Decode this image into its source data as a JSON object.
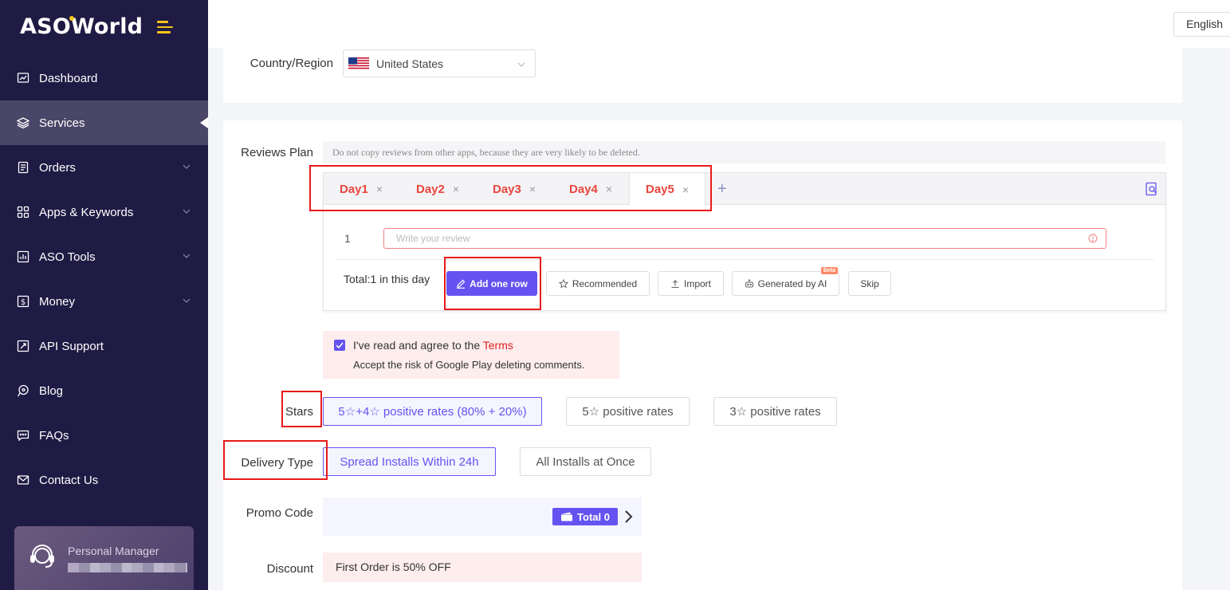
{
  "brand": {
    "part1": "AS",
    "o": "O",
    "part2": "World"
  },
  "topbar": {
    "language": "English"
  },
  "nav": [
    {
      "label": "Dashboard",
      "icon": "dashboard-icon",
      "expandable": false,
      "active": false
    },
    {
      "label": "Services",
      "icon": "layers-icon",
      "expandable": false,
      "active": true
    },
    {
      "label": "Orders",
      "icon": "orders-icon",
      "expandable": true,
      "active": false
    },
    {
      "label": "Apps & Keywords",
      "icon": "grid-icon",
      "expandable": true,
      "active": false
    },
    {
      "label": "ASO Tools",
      "icon": "chart-icon",
      "expandable": true,
      "active": false
    },
    {
      "label": "Money",
      "icon": "money-icon",
      "expandable": true,
      "active": false
    },
    {
      "label": "API Support",
      "icon": "api-icon",
      "expandable": false,
      "active": false
    },
    {
      "label": "Blog",
      "icon": "blog-icon",
      "expandable": false,
      "active": false
    },
    {
      "label": "FAQs",
      "icon": "faq-icon",
      "expandable": false,
      "active": false
    },
    {
      "label": "Contact Us",
      "icon": "mail-icon",
      "expandable": false,
      "active": false
    }
  ],
  "personal_manager": {
    "label": "Personal Manager"
  },
  "country": {
    "label": "Country/Region",
    "value": "United States"
  },
  "reviews": {
    "label": "Reviews Plan",
    "notice": "Do not copy reviews from other apps, because they are very likely to be deleted.",
    "tabs": [
      "Day1",
      "Day2",
      "Day3",
      "Day4",
      "Day5"
    ],
    "active_tab": "Day5",
    "tab_close": "×",
    "tab_add": "+",
    "row_number": "1",
    "input_placeholder": "Write your review",
    "total_text": "Total:1 in this day",
    "buttons": {
      "add_row": "Add one row",
      "recommended": "Recommended",
      "import": "Import",
      "generated_ai": "Generated by AI",
      "beta": "Beta",
      "skip": "Skip"
    }
  },
  "agreement": {
    "checked": true,
    "line1": "I've read and agree to the ",
    "terms": "Terms",
    "line2": "Accept the risk of Google Play deleting comments."
  },
  "stars": {
    "label": "Stars",
    "options": [
      "5☆+4☆ positive rates (80% + 20%)",
      "5☆ positive rates",
      "3☆ positive rates"
    ],
    "selected_index": 0
  },
  "delivery": {
    "label": "Delivery Type",
    "options": [
      "Spread Installs Within 24h",
      "All Installs at Once"
    ],
    "selected_index": 0
  },
  "promo": {
    "label": "Promo Code",
    "badge": "Total 0"
  },
  "discount": {
    "label": "Discount",
    "value": "First Order is 50% OFF"
  },
  "colors": {
    "sidebar": "#1f1b44",
    "accent": "#6553f1",
    "danger": "#e8463d",
    "annotation": "#e81a1a"
  }
}
